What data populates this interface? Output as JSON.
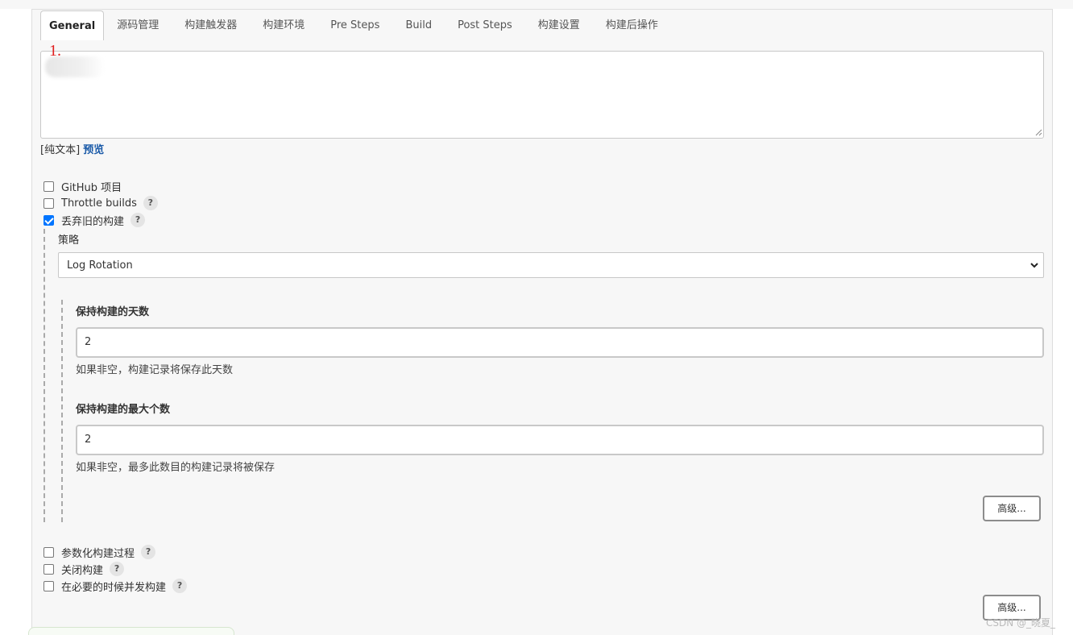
{
  "tabs": [
    {
      "label": "General",
      "active": true
    },
    {
      "label": "源码管理",
      "active": false
    },
    {
      "label": "构建触发器",
      "active": false
    },
    {
      "label": "构建环境",
      "active": false
    },
    {
      "label": "Pre Steps",
      "active": false
    },
    {
      "label": "Build",
      "active": false
    },
    {
      "label": "Post Steps",
      "active": false
    },
    {
      "label": "构建设置",
      "active": false
    },
    {
      "label": "构建后操作",
      "active": false
    }
  ],
  "annotation": "1.",
  "description": {
    "value": "",
    "markup_prefix": "[纯文本]",
    "preview_link": "预览"
  },
  "options": {
    "github_project": {
      "label": "GitHub 项目",
      "checked": false
    },
    "throttle_builds": {
      "label": "Throttle builds",
      "checked": false,
      "help": "?"
    },
    "discard_old_builds": {
      "label": "丢弃旧的构建",
      "checked": true,
      "help": "?"
    }
  },
  "strategy": {
    "label": "策略",
    "selected": "Log Rotation"
  },
  "days_to_keep": {
    "label": "保持构建的天数",
    "value": "2",
    "help_text": "如果非空，构建记录将保存此天数"
  },
  "max_builds": {
    "label": "保持构建的最大个数",
    "value": "2",
    "help_text": "如果非空，最多此数目的构建记录将被保存"
  },
  "advanced_button": "高级...",
  "more_options": {
    "parameterized": {
      "label": "参数化构建过程",
      "checked": false,
      "help": "?"
    },
    "disable_build": {
      "label": "关闭构建",
      "checked": false,
      "help": "?"
    },
    "concurrent": {
      "label": "在必要的时候并发构建",
      "checked": false,
      "help": "?"
    }
  },
  "advanced_button_2": "高级...",
  "watermark": "CSDN @_晓夏_",
  "colors": {
    "panel_bg": "#f7f7f7",
    "link_blue": "#1a5aa8",
    "checkbox_checked": "#0075ff",
    "annotation_red": "#e02020"
  }
}
